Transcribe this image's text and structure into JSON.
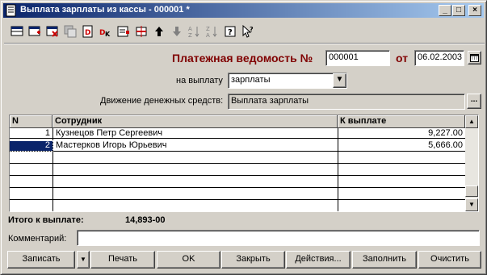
{
  "window": {
    "title": "Выплата зарплаты из кассы - 000001 *",
    "controls": {
      "minimize": "_",
      "maximize": "□",
      "close": "×"
    }
  },
  "toolbar": {
    "icons": [
      "new-row-icon",
      "add-row-icon",
      "delete-row-icon",
      "copy-row-icon",
      "d-icon",
      "dk-icon",
      "edit-icon",
      "filter-icon",
      "move-up-icon",
      "move-down-icon",
      "sort-asc-icon",
      "sort-desc-icon",
      "help-icon",
      "what-is-this-icon"
    ]
  },
  "doc": {
    "heading": "Платежная ведомость №",
    "number": "000001",
    "from_label": "от",
    "date": "06.02.2003"
  },
  "payout": {
    "label": "на выплату",
    "value": "зарплаты"
  },
  "cashflow": {
    "label": "Движение денежных средств:",
    "value": "Выплата зарплаты",
    "button": "..."
  },
  "table": {
    "columns": [
      "N",
      "Сотрудник",
      "К выплате"
    ],
    "rows": [
      {
        "n": "1",
        "employee": "Кузнецов Петр Сергеевич",
        "amount": "9,227.00"
      },
      {
        "n": "2",
        "employee": "Мастерков Игорь Юрьевич",
        "amount": "5,666.00"
      }
    ]
  },
  "total": {
    "label": "Итого к выплате:",
    "value": "14,893-00"
  },
  "comment": {
    "label": "Комментарий:",
    "value": ""
  },
  "buttons": {
    "save": "Записать",
    "save_menu": "▼",
    "print": "Печать",
    "ok": "OK",
    "close": "Закрыть",
    "actions": "Действия...",
    "fill": "Заполнить",
    "clear": "Очистить"
  },
  "colors": {
    "heading": "#800000",
    "title_bar_start": "#0a246a",
    "title_bar_end": "#a6caf0",
    "selection": "#0a246a"
  }
}
